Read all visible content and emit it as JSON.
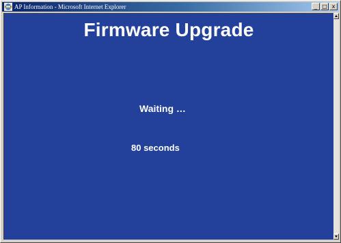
{
  "window": {
    "title": "AP Information - Microsoft Internet Explorer",
    "icon": "internet-explorer-icon",
    "buttons": {
      "minimize": "_",
      "maximize": "□",
      "close": "x"
    }
  },
  "page": {
    "heading": "Firmware Upgrade",
    "status": "Waiting …",
    "countdown": "80 seconds",
    "background_color": "#23419b",
    "text_color": "#ffffff"
  }
}
